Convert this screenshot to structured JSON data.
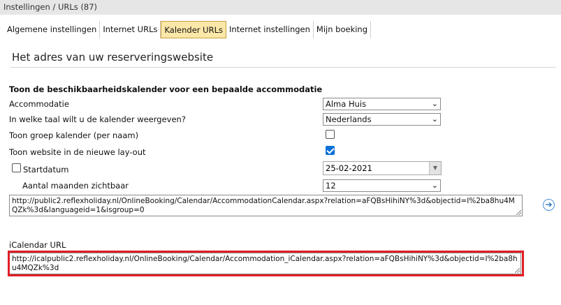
{
  "window": {
    "title": "Instellingen / URLs (87)"
  },
  "tabs": [
    {
      "label": "Algemene instellingen",
      "active": false
    },
    {
      "label": "Internet URLs",
      "active": false
    },
    {
      "label": "Kalender URLs",
      "active": true
    },
    {
      "label": "Internet instellingen",
      "active": false
    },
    {
      "label": "Mijn boeking",
      "active": false
    }
  ],
  "section": {
    "title": "Het adres van uw reserveringswebsite"
  },
  "form": {
    "heading": "Toon de beschikbaarheidskalender voor een bepaalde accommodatie",
    "accommodation": {
      "label": "Accommodatie",
      "value": "Alma Huis"
    },
    "language": {
      "label": "In welke taal wilt u de kalender weergeven?",
      "value": "Nederlands"
    },
    "group_calendar": {
      "label": "Toon groep kalender (per naam)",
      "checked": false
    },
    "new_layout": {
      "label": "Toon website in de nieuwe lay-out",
      "checked": true
    },
    "start_date": {
      "label": "Startdatum",
      "checked": false,
      "value": "25-02-2021"
    },
    "months": {
      "label": "Aantal maanden zichtbaar",
      "value": "12"
    },
    "calendar_url": "http://public2.reflexholiday.nl/OnlineBooking/Calendar/AccommodationCalendar.aspx?relation=aFQBsHihiNY%3d&objectid=I%2ba8hu4MQZk%3d&languageid=1&isgroup=0",
    "ical_label": "iCalendar URL",
    "ical_url": "http://icalpublic2.reflexholiday.nl/OnlineBooking/Calendar/Accommodation_iCalendar.aspx?relation=aFQBsHihiNY%3d&objectid=I%2ba8hu4MQZk%3d"
  },
  "colors": {
    "tab_active_bg": "#fbe7a8",
    "checkbox_checked": "#0a6fd6",
    "highlight_border": "#e01e26"
  },
  "icons": {
    "go": "arrow-right-circle"
  }
}
